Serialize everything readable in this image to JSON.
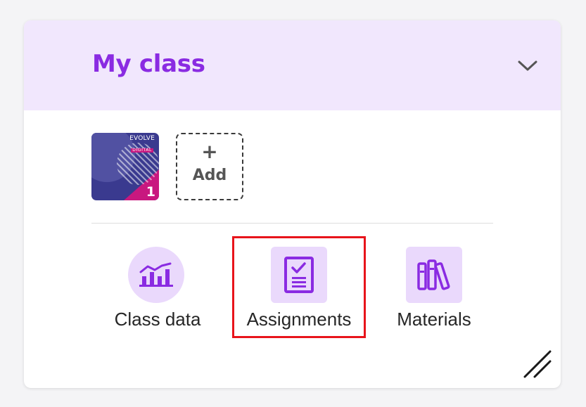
{
  "card": {
    "title": "My class",
    "accent_color": "#8a2be2",
    "header_bg": "#f1e7fd",
    "collapse_icon": "chevron-down-icon"
  },
  "books": [
    {
      "brand": "EVOLVE",
      "brand_sub": "DIGITAL",
      "level": "1"
    }
  ],
  "add_book": {
    "icon": "plus-icon",
    "label": "Add"
  },
  "tools": [
    {
      "label": "Class data",
      "icon": "chart-icon"
    },
    {
      "label": "Assignments",
      "icon": "assignment-icon",
      "highlighted": true
    },
    {
      "label": "Materials",
      "icon": "books-icon"
    }
  ],
  "highlight_color": "#e8141b",
  "resize_icon": "resize-handle-icon"
}
